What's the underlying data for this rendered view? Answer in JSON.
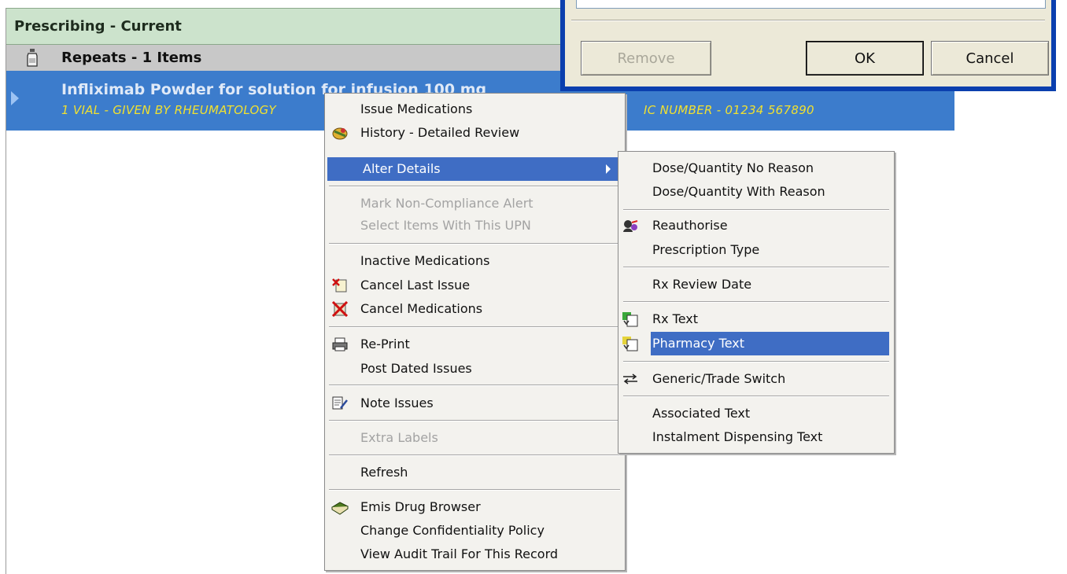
{
  "panel": {
    "title": "Prescribing - Current",
    "group_label": "Repeats - 1 Items",
    "drug_name": "Infliximab  Powder for solution for infusion  100 mg",
    "drug_note": "1 VIAL - GIVEN BY RHEUMATOLOGY",
    "drug_note_right": "IC NUMBER - 01234 567890"
  },
  "dialog": {
    "remove_label": "Remove",
    "ok_label": "OK",
    "cancel_label": "Cancel"
  },
  "context_menu": {
    "items": [
      {
        "label": "Issue Medications",
        "icon": "none"
      },
      {
        "label": "History - Detailed Review",
        "icon": "history-icon"
      },
      {
        "label": "Alter Details",
        "icon": "submenu-arrow-icon"
      },
      {
        "label": "Mark Non-Compliance Alert",
        "icon": "none"
      },
      {
        "label": "Select Items With This UPN",
        "icon": "none"
      },
      {
        "label": "Inactive Medications",
        "icon": "none"
      },
      {
        "label": "Cancel Last Issue",
        "icon": "cancel-last-issue-icon"
      },
      {
        "label": "Cancel Medications",
        "icon": "cancel-medications-icon"
      },
      {
        "label": "Re-Print",
        "icon": "printer-icon"
      },
      {
        "label": "Post Dated Issues",
        "icon": "none"
      },
      {
        "label": "Note Issues",
        "icon": "note-icon"
      },
      {
        "label": "Extra Labels",
        "icon": "none"
      },
      {
        "label": "Refresh",
        "icon": "none"
      },
      {
        "label": "Emis Drug Browser",
        "icon": "book-icon"
      },
      {
        "label": "Change Confidentiality Policy",
        "icon": "none"
      },
      {
        "label": "View Audit Trail For This Record",
        "icon": "none"
      }
    ]
  },
  "submenu": {
    "items": [
      {
        "label": "Dose/Quantity No Reason"
      },
      {
        "label": "Dose/Quantity With Reason"
      },
      {
        "label": "Reauthorise",
        "icon": "reauthorise-icon"
      },
      {
        "label": "Prescription Type"
      },
      {
        "label": "Rx Review Date"
      },
      {
        "label": "Rx Text",
        "icon": "rx-text-icon"
      },
      {
        "label": "Pharmacy Text",
        "icon": "pharmacy-text-icon"
      },
      {
        "label": "Generic/Trade Switch",
        "icon": "switch-icon"
      },
      {
        "label": "Associated Text"
      },
      {
        "label": "Instalment Dispensing Text"
      }
    ]
  },
  "colors": {
    "selection_blue": "#3c7ccc",
    "menu_highlight": "#3f6dc4",
    "header_green": "#cce3cc",
    "note_yellow": "#f0e030"
  }
}
